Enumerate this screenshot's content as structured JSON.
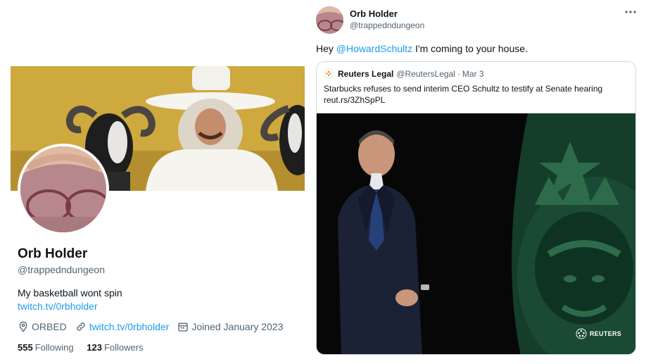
{
  "profile": {
    "display_name": "Orb Holder",
    "handle": "@trappedndungeon",
    "bio": "My basketball wont spin",
    "bio_link": "twitch.tv/0rbholder",
    "location": "ORBED",
    "website": "twitch.tv/0rbholder",
    "joined": "Joined January 2023",
    "following_count": "555",
    "following_label": "Following",
    "followers_count": "123",
    "followers_label": "Followers"
  },
  "tweet": {
    "author_name": "Orb Holder",
    "author_handle": "@trappedndungeon",
    "text_prefix": "Hey ",
    "mention": "@HowardSchultz",
    "text_suffix": " I'm coming to your house.",
    "quote": {
      "author_name": "Reuters Legal",
      "author_handle": "@ReutersLegal",
      "separator": "·",
      "date": "Mar 3",
      "text": "Starbucks refuses to send interim CEO Schultz to testify at Senate hearing",
      "link": "reut.rs/3ZhSpPL",
      "image_watermark": "REUTERS"
    }
  },
  "icons": {
    "location": "location-pin-icon",
    "website": "link-icon",
    "joined": "calendar-icon",
    "more": "more-options-icon"
  },
  "colors": {
    "link": "#1d9bf0",
    "primary_text": "#0f1419",
    "secondary_text": "#536471",
    "border": "#cfd9de",
    "starbucks_green": "#1e5a3a"
  }
}
